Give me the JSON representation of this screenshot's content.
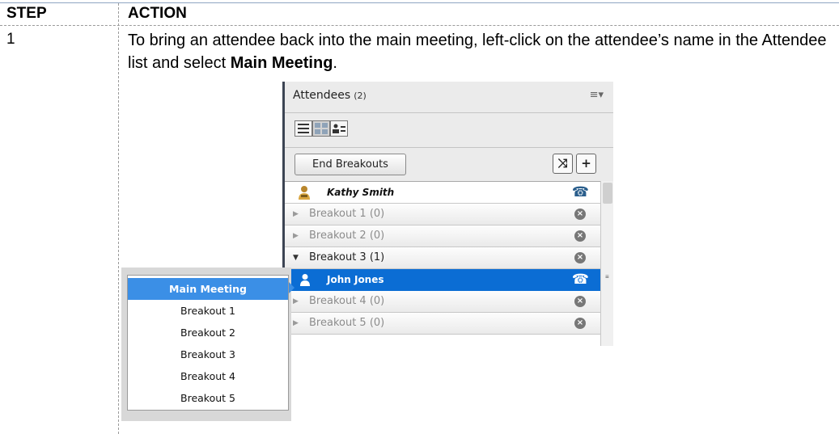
{
  "doc": {
    "step_header": "STEP",
    "action_header": "ACTION",
    "step_number": "1",
    "instruction_before": "To bring an attendee back into the main meeting, left-click on the attendee’s name in the Attendee list and select ",
    "instruction_bold": "Main Meeting",
    "instruction_after": "."
  },
  "panel": {
    "title": "Attendees",
    "count": "(2)",
    "menu_icon": "menu-icon",
    "end_breakouts_label": "End Breakouts",
    "shuffle_glyph": "⤨",
    "add_glyph": "+",
    "owner": "Kathy Smith",
    "breakouts": [
      {
        "label": "Breakout 1 (0)"
      },
      {
        "label": "Breakout 2 (0)"
      },
      {
        "label": "Breakout 3 (1)"
      },
      {
        "label": "Breakout 4 (0)"
      },
      {
        "label": "Breakout 5 (0)"
      }
    ],
    "selected_attendee": "John Jones",
    "phone_glyph": "☎",
    "close_glyph": "×"
  },
  "context_menu": {
    "items": [
      "Main Meeting",
      "Breakout 1",
      "Breakout 2",
      "Breakout 3",
      "Breakout 4",
      "Breakout 5"
    ]
  },
  "colors": {
    "selection": "#0b6dd4",
    "menu_highlight": "#3b8fe6"
  }
}
